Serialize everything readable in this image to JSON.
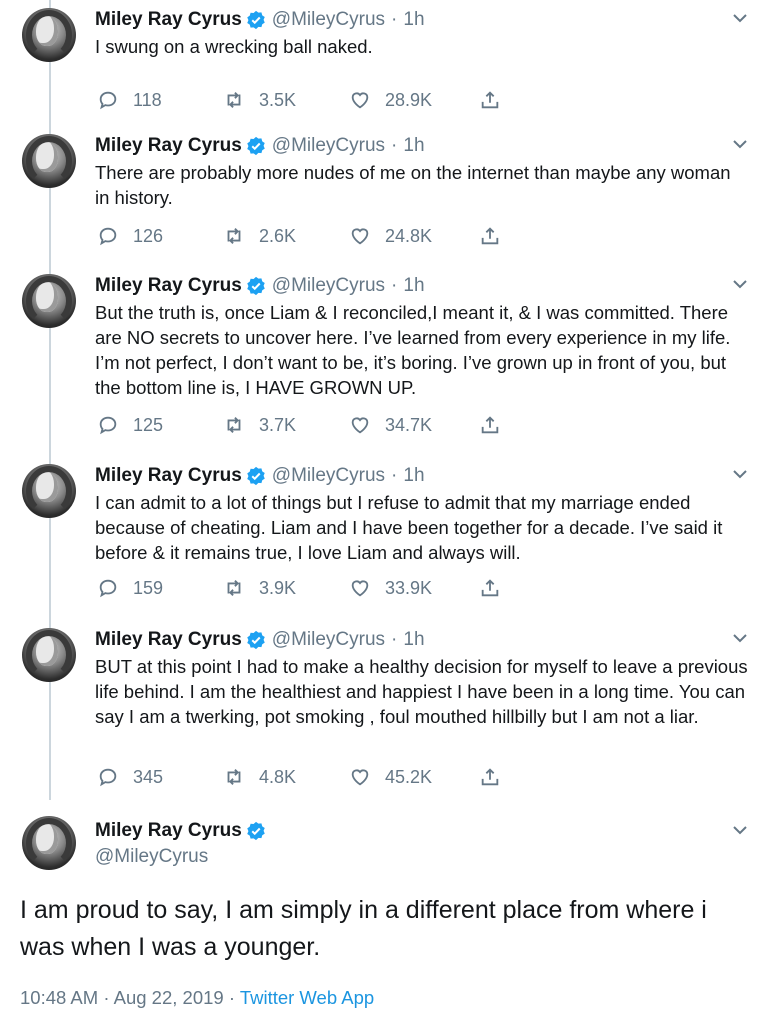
{
  "colors": {
    "verified": "#1da1f2",
    "secondary": "#657786",
    "link": "#1b95e0",
    "thread_line": "#ccd6dd"
  },
  "tweets": [
    {
      "name": "Miley Ray Cyrus",
      "handle": "@MileyCyrus",
      "sep": "·",
      "time": "1h",
      "text": "I swung on a wrecking ball naked.",
      "replies": "118",
      "retweets": "3.5K",
      "likes": "28.9K"
    },
    {
      "name": "Miley Ray Cyrus",
      "handle": "@MileyCyrus",
      "sep": "·",
      "time": "1h",
      "text": "There are probably more nudes of me on the internet than maybe any woman in history.",
      "replies": "126",
      "retweets": "2.6K",
      "likes": "24.8K"
    },
    {
      "name": "Miley Ray Cyrus",
      "handle": "@MileyCyrus",
      "sep": "·",
      "time": "1h",
      "text": "But the truth is, once Liam & I reconciled,I meant it, & I was committed. There are NO secrets to uncover here. I’ve learned from every experience in my life. I’m not perfect, I don’t want to be, it’s boring. I’ve grown up in front of you, but the bottom line is, I HAVE GROWN UP.",
      "replies": "125",
      "retweets": "3.7K",
      "likes": "34.7K"
    },
    {
      "name": "Miley Ray Cyrus",
      "handle": "@MileyCyrus",
      "sep": "·",
      "time": "1h",
      "text": "I can admit to a lot of things but I refuse to admit that my marriage ended because of cheating. Liam and I have been together for a decade. I’ve said it before & it remains true, I love Liam and always will.",
      "replies": "159",
      "retweets": "3.9K",
      "likes": "33.9K"
    },
    {
      "name": "Miley Ray Cyrus",
      "handle": "@MileyCyrus",
      "sep": "·",
      "time": "1h",
      "text": "BUT at this point I had to make a healthy decision for myself to leave a previous life behind. I am the healthiest and happiest I have been in a long time.  You can say I am a twerking, pot smoking , foul mouthed hillbilly but I am not a liar.",
      "replies": "345",
      "retweets": "4.8K",
      "likes": "45.2K"
    }
  ],
  "main_tweet": {
    "name": "Miley Ray Cyrus",
    "handle": "@MileyCyrus",
    "text": "I am proud to say, I am simply in a different place from where i was when I was a younger.",
    "time": "10:48 AM",
    "sep1": "·",
    "date": "Aug 22, 2019",
    "sep2": "·",
    "app": "Twitter Web App"
  },
  "icons": [
    "avatar",
    "verified-badge-icon",
    "chevron-down-icon",
    "reply-icon",
    "retweet-icon",
    "like-icon",
    "share-icon"
  ]
}
